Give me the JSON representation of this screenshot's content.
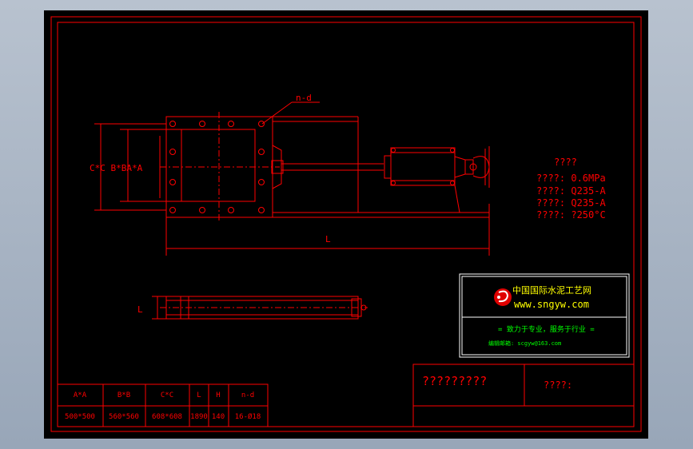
{
  "drawing": {
    "callout_nd": "n-d",
    "dim_left_stack": "C*C  B*BA*A",
    "dim_length": "L",
    "dim_plan_height": "L",
    "specs": {
      "heading": "????",
      "pressure": "????: 0.6MPa",
      "material_a": "????: Q235-A",
      "material_b": "????: Q235-A",
      "temperature": "????: ?250°C"
    },
    "logo_box": {
      "company_cn": "中国国际水泥工艺网",
      "website": "www.sngyw.com",
      "slogan": "= 致力于专业，服务于行业 =",
      "contact": "编辑邮箱: scgyw@163.com"
    },
    "title_block": {
      "drawing_title": "?????????",
      "drawing_no_label": "????:"
    },
    "param_table": {
      "headers": [
        "A*A",
        "B*B",
        "C*C",
        "L",
        "H",
        "n-d"
      ],
      "values": [
        "500*500",
        "560*560",
        "608*608",
        "1890",
        "140",
        "16-Ø18"
      ]
    }
  },
  "colors": {
    "line": "#ff0000",
    "text": "#ff0000",
    "logo_text": "#ffff00",
    "sheet_bg": "#000000",
    "logo_green": "#00cc00",
    "frame_white": "#ffffff"
  }
}
